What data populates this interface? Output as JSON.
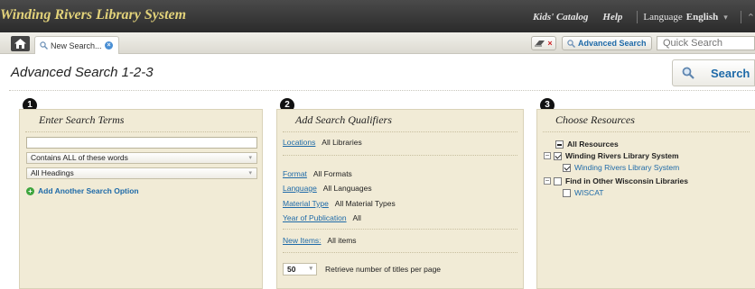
{
  "topbar": {
    "brand": "Winding Rivers Library System",
    "kids_catalog": "Kids' Catalog",
    "help": "Help",
    "language_label": "Language",
    "language_value": "English"
  },
  "tabs": {
    "active_tab": "New Search...",
    "advanced_search": "Advanced Search",
    "quick_search_placeholder": "Quick Search"
  },
  "header": {
    "title": "Advanced Search 1-2-3",
    "search_button": "Search"
  },
  "panel1": {
    "step": "1",
    "title": "Enter Search Terms",
    "terms_value": "",
    "match_select": "Contains ALL of these words",
    "field_select": "All Headings",
    "add_option": "Add Another Search Option"
  },
  "panel2": {
    "step": "2",
    "title": "Add Search Qualifiers",
    "locations_label": "Locations",
    "locations_value": "All Libraries",
    "format_label": "Format",
    "format_value": "All Formats",
    "language_label": "Language",
    "language_value": "All Languages",
    "material_label": "Material Type",
    "material_value": "All Material Types",
    "year_label": "Year of Publication",
    "year_value": "All",
    "newitems_label": "New Items:",
    "newitems_value": "All items",
    "per_page_value": "50",
    "per_page_label": "Retrieve number of titles per page"
  },
  "panel3": {
    "step": "3",
    "title": "Choose Resources",
    "all_resources": "All Resources",
    "group1": "Winding Rivers Library System",
    "group1_item": "Winding Rivers Library System",
    "group2": "Find in Other Wisconsin Libraries",
    "group2_item": "WISCAT"
  },
  "colors": {
    "panel_bg": "#f1ebd6",
    "link": "#1e6aa8",
    "brand": "#e2d27a",
    "topbar": "#333333"
  }
}
